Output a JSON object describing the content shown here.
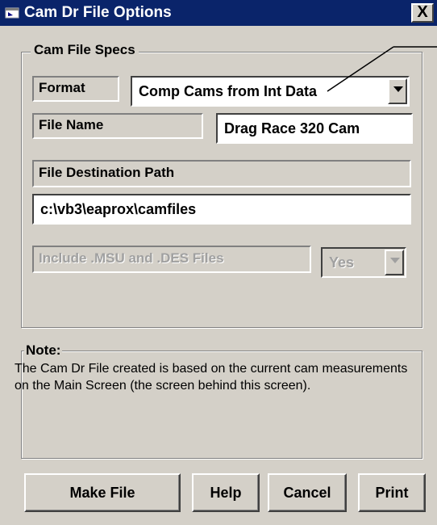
{
  "window": {
    "title": "Cam Dr File Options",
    "close_label": "X"
  },
  "cam_file_specs": {
    "caption": "Cam File Specs",
    "format_label": "Format",
    "format_value": "Comp Cams from Int Data",
    "file_name_label": "File Name",
    "file_name_value": "Drag Race 320 Cam",
    "destination_label": "File Destination Path",
    "destination_value": "c:\\vb3\\eaprox\\camfiles",
    "include_label": "Include .MSU and .DES Files",
    "include_value": "Yes"
  },
  "note": {
    "caption": "Note:",
    "text": "The Cam Dr File created is based on the current cam measurements on the Main Screen (the screen behind this screen)."
  },
  "buttons": {
    "make_file": "Make File",
    "help": "Help",
    "cancel": "Cancel",
    "print": "Print"
  },
  "colors": {
    "titlebar": "#0a246a",
    "face": "#d4d0c8",
    "disabled_text": "#a0a0a0"
  }
}
